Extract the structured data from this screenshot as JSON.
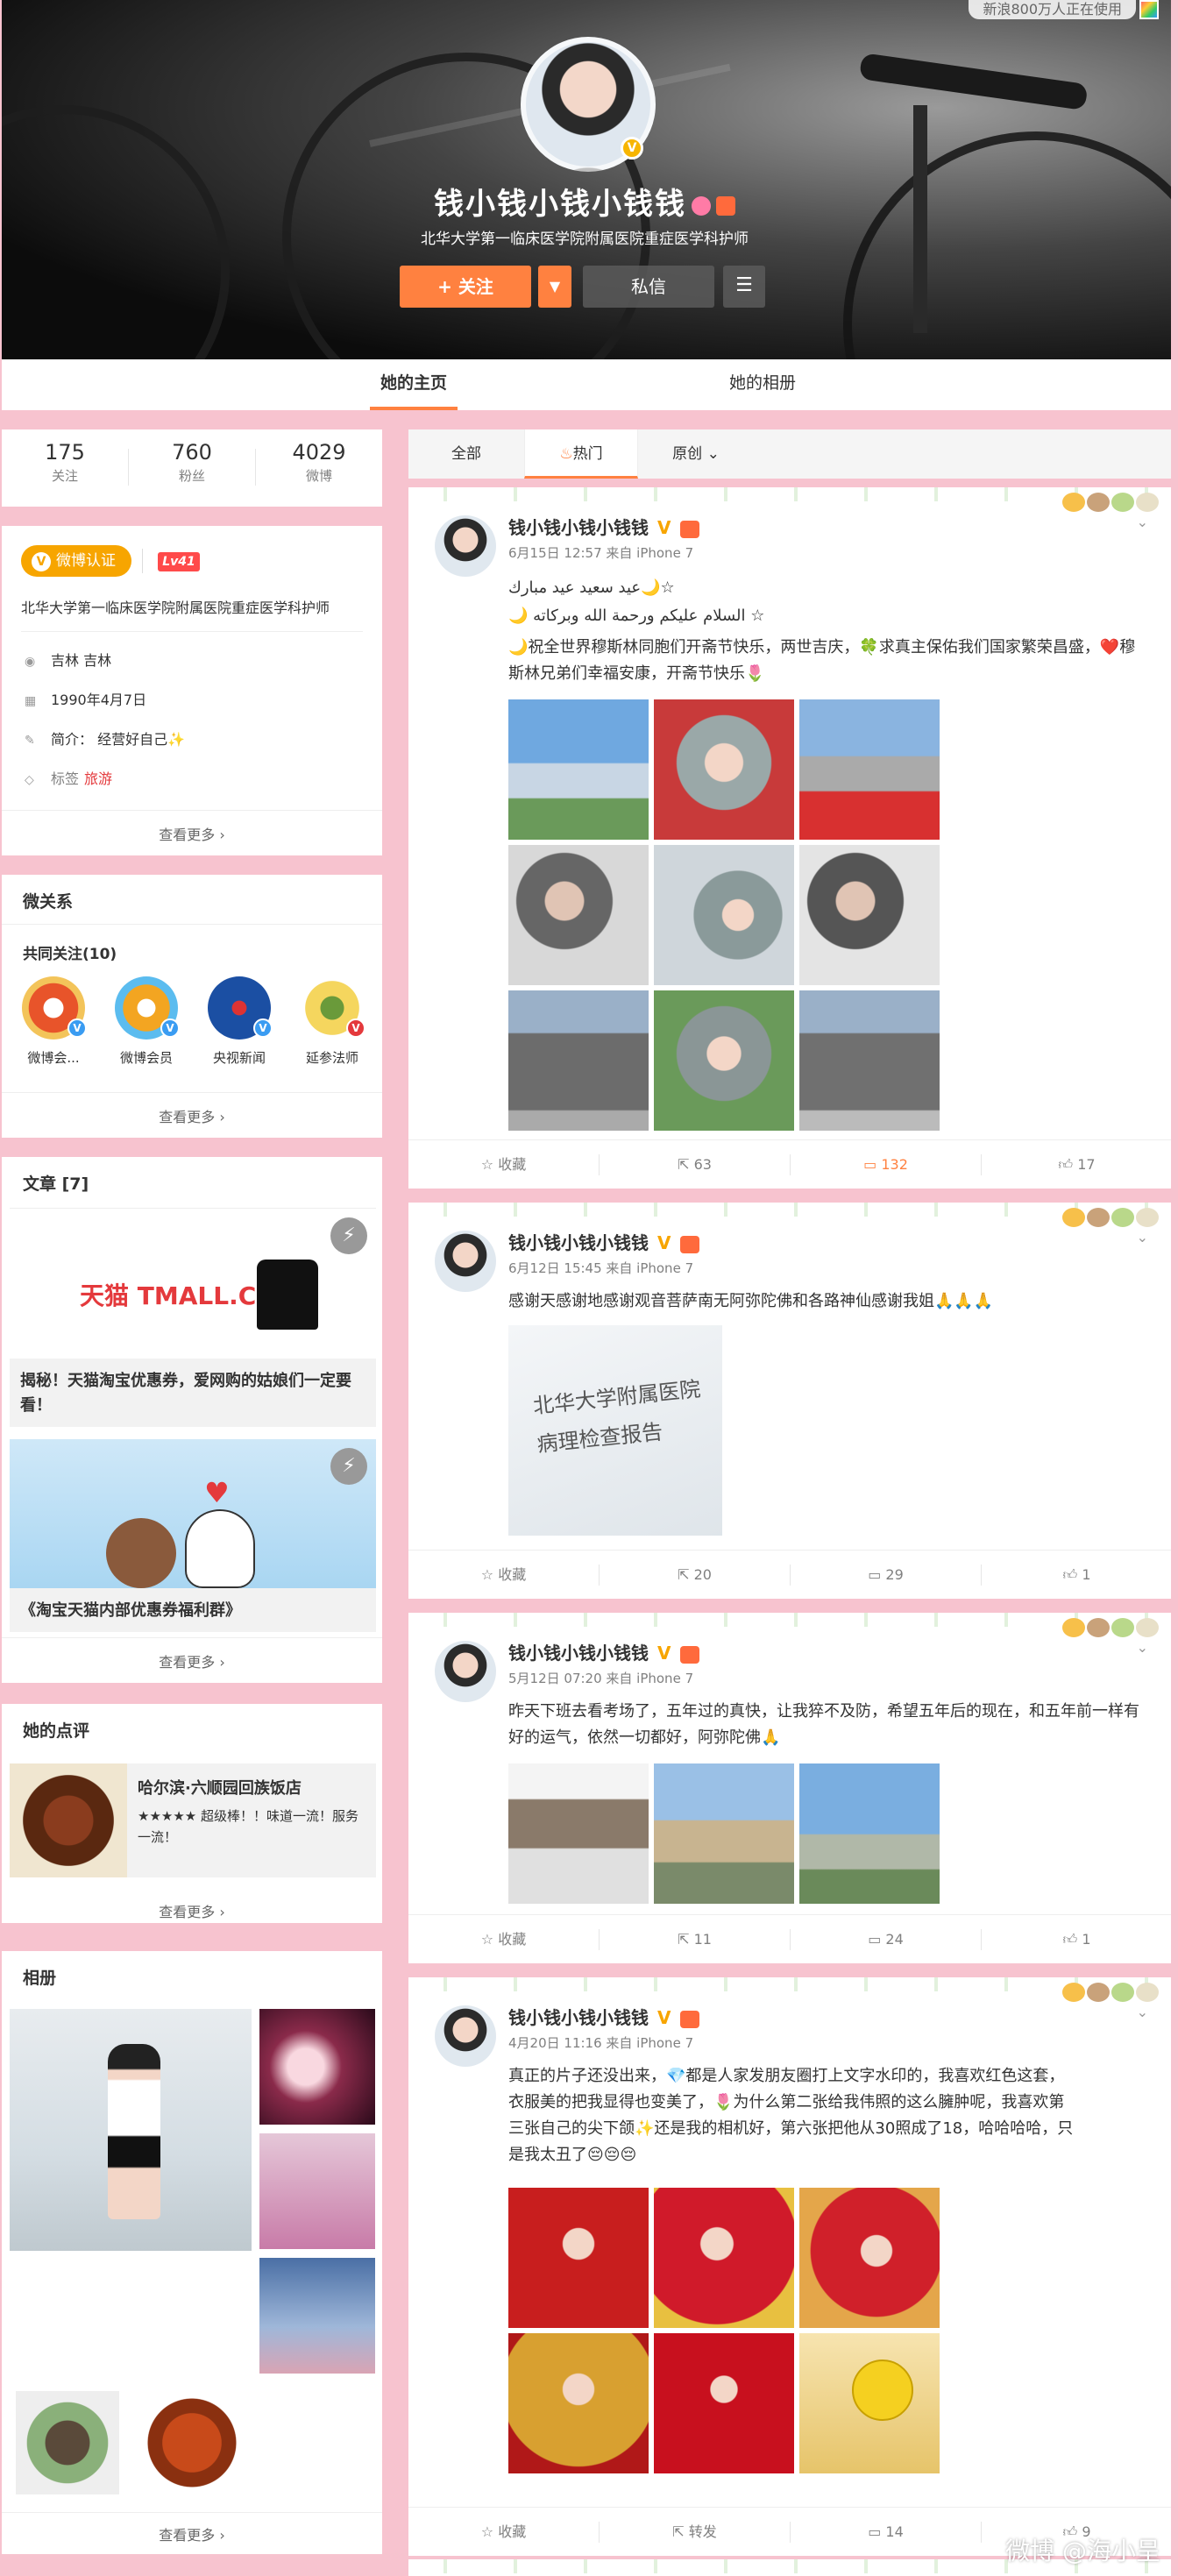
{
  "header": {
    "top_badge": "新浪800万人正在使用",
    "name": "钱小钱小钱小钱钱",
    "bio": "北华大学第一临床医学院附属医院重症医学科护师",
    "follow_label": "+ 关注",
    "message_label": "私信",
    "tabs": {
      "home": "她的主页",
      "album": "她的相册"
    }
  },
  "stats": [
    {
      "value": "175",
      "label": "关注"
    },
    {
      "value": "760",
      "label": "粉丝"
    },
    {
      "value": "4029",
      "label": "微博"
    }
  ],
  "info": {
    "verify_label": "微博认证",
    "level": "Lv41",
    "description": "北华大学第一临床医学院附属医院重症医学科护师",
    "location": "吉林 吉林",
    "birthday": "1990年4月7日",
    "intro": "简介： 经营好自己✨",
    "tags_label": "标签",
    "tag": "旅游",
    "see_more": "查看更多 ›"
  },
  "relations": {
    "title": "微关系",
    "subtitle": "共同关注(10)",
    "items": [
      {
        "name": "微博会...",
        "color": "#e8542a",
        "badge_color": "#3a9cf2"
      },
      {
        "name": "微博会员",
        "color": "#f3a521",
        "badge_color": "#3a9cf2"
      },
      {
        "name": "央视新闻",
        "color": "#1b4fa3",
        "badge_color": "#3a9cf2"
      },
      {
        "name": "延参法师",
        "color": "#f5d65e",
        "badge_color": "#e4393c"
      }
    ],
    "see_more": "查看更多 ›"
  },
  "articles": {
    "title": "文章 [7]",
    "items": [
      {
        "title": "揭秘！天猫淘宝优惠券，爱网购的姑娘们一定要看！",
        "image_text": "天猫 TMALL.COM"
      },
      {
        "title": "《淘宝天猫内部优惠券福利群》"
      }
    ],
    "see_more": "查看更多 ›"
  },
  "reviews": {
    "title": "她的点评",
    "name": "哈尔滨·六顺园回族饭店",
    "text": "★★★★★ 超级棒！！味道一流！服务一流！",
    "see_more": "查看更多 ›"
  },
  "album": {
    "title": "相册",
    "see_more": "查看更多 ›"
  },
  "feed": {
    "tabs": {
      "all": "全部",
      "hot": "热门",
      "original": "原创 ⌄"
    },
    "posts": [
      {
        "name": "钱小钱小钱小钱钱",
        "meta": "6月15日 12:57 来自 iPhone 7",
        "lines": [
          "عيد سعيد عيد مبارك🌙☆",
          "🌙 السلام عليكم ورحمة الله وبركاته ☆",
          "🌙祝全世界穆斯林同胞们开斋节快乐，两世吉庆，🍀求真主保佑我们国家繁荣昌盛，❤️穆斯林兄弟们幸福安康，开斋节快乐🌷"
        ],
        "actions": [
          "收藏",
          "63",
          "132",
          "17"
        ]
      },
      {
        "name": "钱小钱小钱小钱钱",
        "meta": "6月12日 15:45 来自 iPhone 7",
        "lines": [
          "感谢天感谢地感谢观音菩萨南无阿弥陀佛和各路神仙感谢我姐🙏🙏🙏"
        ],
        "doc_image_text": "北华大学附属医院 病理检查报告",
        "actions": [
          "收藏",
          "20",
          "29",
          "1"
        ]
      },
      {
        "name": "钱小钱小钱小钱钱",
        "meta": "5月12日 07:20 来自 iPhone 7",
        "lines": [
          "昨天下班去看考场了，五年过的真快，让我猝不及防，希望五年后的现在，和五年前一样有好的运气，依然一切都好，阿弥陀佛🙏"
        ],
        "actions": [
          "收藏",
          "11",
          "24",
          "1"
        ]
      },
      {
        "name": "钱小钱小钱小钱钱",
        "meta": "4月20日 11:16 来自 iPhone 7",
        "lines": [
          "真正的片子还没出来，💎都是人家发朋友圈打上文字水印的，我喜欢红色这套，",
          "衣服美的把我显得也变美了，🌷为什么第二张给我伟照的这么臃肿呢，我喜欢第",
          "三张自己的尖下颌✨还是我的相机好，第六张把他从30照成了18，哈哈哈哈，只",
          "是我太丑了😔😔😔"
        ],
        "actions": [
          "收藏",
          "转发",
          "14",
          "9"
        ]
      }
    ]
  },
  "watermark": "微博 @海小呈",
  "colors": {
    "accent": "#ff8140",
    "page_bg": "#f7c3cf",
    "verify": "#f7a500",
    "level": "#ff4a4a"
  }
}
